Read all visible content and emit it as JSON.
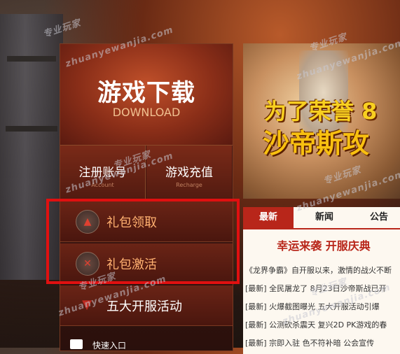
{
  "download": {
    "title": "游戏下载",
    "subtitle": "DOWNLOAD"
  },
  "actions": [
    {
      "label": "注册账号",
      "sub": "Account"
    },
    {
      "label": "游戏充值",
      "sub": "Recharge"
    }
  ],
  "menu": [
    {
      "label": "礼包领取",
      "icon": "flag-icon"
    },
    {
      "label": "礼包激活",
      "icon": "swords-icon"
    },
    {
      "label": "五大开服活动",
      "icon": "ribbon-icon"
    }
  ],
  "quick_entry": "快速入口",
  "banner": {
    "line1": "为了荣誉 8",
    "line2": "沙帝斯攻"
  },
  "news": {
    "tabs": [
      "最新",
      "新闻",
      "公告"
    ],
    "headline": "幸运来袭 开服庆典",
    "items": [
      "《龙界争霸》自开服以来，激情的战火不断",
      "[最新] 全民屠龙了 8月23日沙帝斯战已开",
      "[最新] 火爆截图曝光 五大开服活动引爆",
      "[最新] 公测砍杀震天 复兴2D PK游戏的春",
      "[最新] 宗即入驻 色不符补暗 公会宣传"
    ]
  },
  "watermarks": [
    "专业玩家",
    "zhuanyewanjia.com"
  ]
}
